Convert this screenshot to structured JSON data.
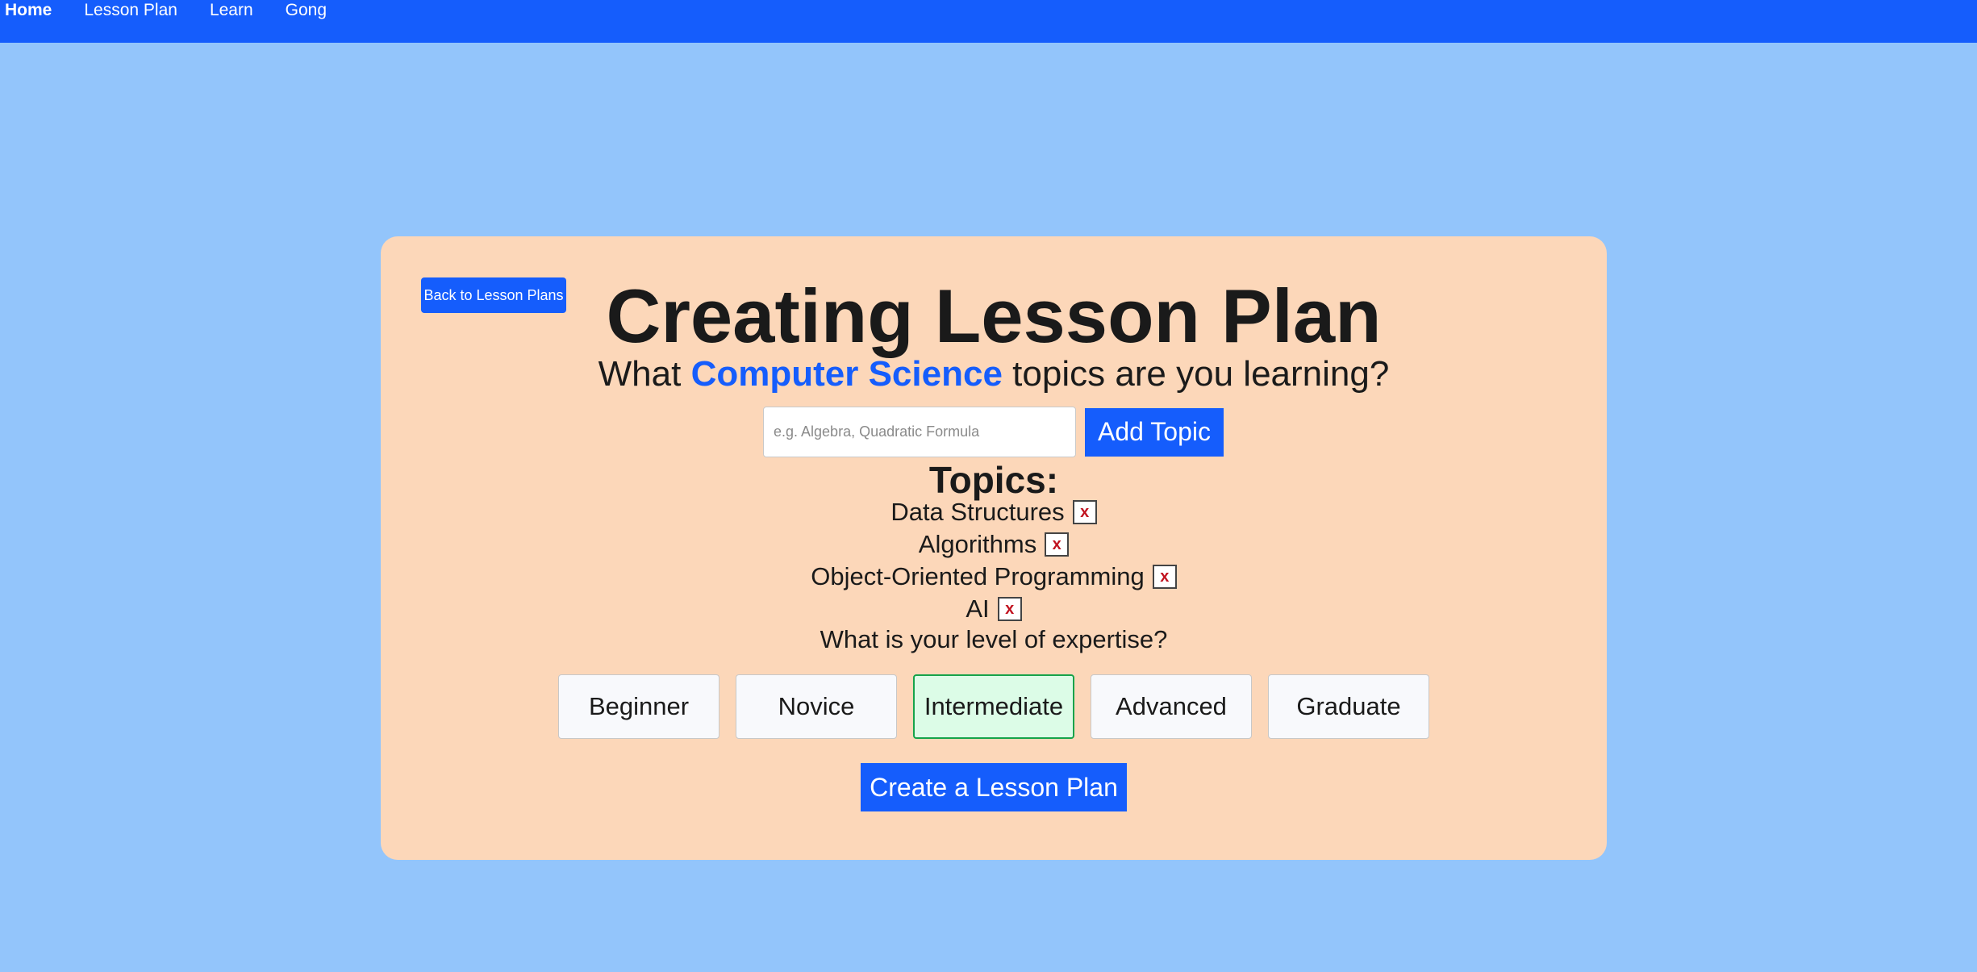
{
  "nav": {
    "items": [
      {
        "label": "Home",
        "active": true
      },
      {
        "label": "Lesson Plan",
        "active": false
      },
      {
        "label": "Learn",
        "active": false
      },
      {
        "label": "Gong",
        "active": false
      }
    ]
  },
  "card": {
    "back_label": "Back to Lesson Plans",
    "title": "Creating Lesson Plan",
    "subtitle_pre": "What ",
    "subtitle_subject": "Computer Science",
    "subtitle_post": " topics are you learning?",
    "topic_input": {
      "value": "",
      "placeholder": "e.g. Algebra, Quadratic Formula"
    },
    "add_topic_label": "Add Topic",
    "topics_heading": "Topics:",
    "topics": [
      {
        "label": "Data Structures",
        "remove_label": "x"
      },
      {
        "label": "Algorithms",
        "remove_label": "x"
      },
      {
        "label": "Object-Oriented Programming",
        "remove_label": "x"
      },
      {
        "label": "AI",
        "remove_label": "x"
      }
    ],
    "expertise_question": "What is your level of expertise?",
    "levels": [
      {
        "label": "Beginner",
        "selected": false
      },
      {
        "label": "Novice",
        "selected": false
      },
      {
        "label": "Intermediate",
        "selected": true
      },
      {
        "label": "Advanced",
        "selected": false
      },
      {
        "label": "Graduate",
        "selected": false
      }
    ],
    "create_label": "Create a Lesson Plan"
  },
  "colors": {
    "page_bg": "#93c5fb",
    "nav_bg": "#155dfc",
    "card_bg": "#fcd7b9",
    "accent": "#155dfc",
    "selected_bg": "#dcfce7",
    "selected_border": "#16a34a",
    "remove_x": "#c1121f"
  }
}
